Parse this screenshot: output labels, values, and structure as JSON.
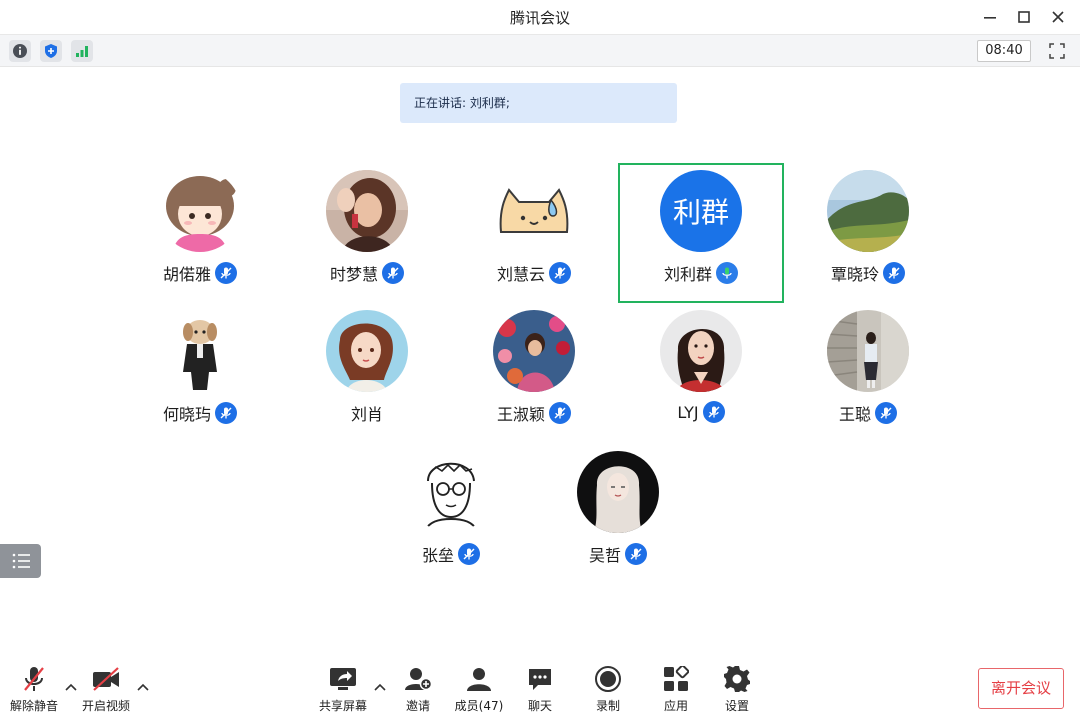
{
  "window": {
    "title": "腾讯会议"
  },
  "infobar": {
    "clock": "08:40"
  },
  "speaking": {
    "text": "正在讲话: 刘利群;"
  },
  "colors": {
    "accent": "#1e6fe6",
    "active_border": "#22b35e",
    "leave": "#e53f45",
    "speaking_bg": "#dce9fb"
  },
  "participants": [
    {
      "name": "胡偌雅",
      "avatar": "cartoon-girl-avatar",
      "muted_icon": "mic-icon"
    },
    {
      "name": "时梦慧",
      "avatar": "photo-avatar",
      "muted_icon": "mic-icon"
    },
    {
      "name": "刘慧云",
      "avatar": "cartoon-cat-avatar",
      "muted_icon": "mic-icon"
    },
    {
      "name": "刘利群",
      "avatar_text": "利群",
      "muted_icon": "mic-speaking-icon",
      "active": true
    },
    {
      "name": "覃晓玲",
      "avatar": "landscape-avatar",
      "muted_icon": "mic-icon"
    },
    {
      "name": "何晓玙",
      "avatar": "dog-avatar",
      "muted_icon": "mic-icon"
    },
    {
      "name": "刘肖",
      "avatar": "illustration-avatar"
    },
    {
      "name": "王淑颖",
      "avatar": "flowers-avatar",
      "muted_icon": "mic-icon"
    },
    {
      "name": "LYJ",
      "avatar": "woman-avatar",
      "muted_icon": "mic-icon"
    },
    {
      "name": "王聪",
      "avatar": "street-avatar",
      "muted_icon": "mic-icon"
    },
    {
      "name": "张垒",
      "avatar": "sketch-man-avatar",
      "muted_icon": "mic-icon"
    },
    {
      "name": "吴哲",
      "avatar": "dark-hair-avatar",
      "muted_icon": "mic-icon"
    }
  ],
  "toolbar": {
    "unmute": "解除静音",
    "start_video": "开启视频",
    "share_screen": "共享屏幕",
    "invite": "邀请",
    "members": "成员(47)",
    "chat": "聊天",
    "record": "录制",
    "apps": "应用",
    "settings": "设置",
    "leave": "离开会议"
  }
}
